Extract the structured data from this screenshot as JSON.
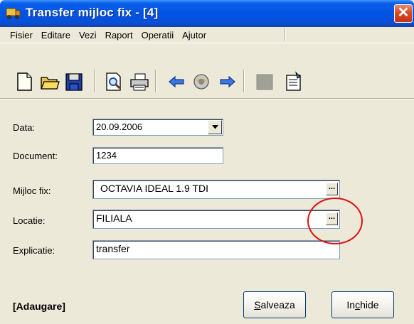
{
  "window": {
    "title": "Transfer mijloc fix - [4]",
    "close_glyph": "✕"
  },
  "menu": [
    "Fisier",
    "Editare",
    "Vezi",
    "Raport",
    "Operatii",
    "Ajutor"
  ],
  "toolbar": {
    "icons": [
      "new-document-icon",
      "open-folder-icon",
      "save-disk-icon",
      "print-preview-icon",
      "print-icon",
      "back-arrow-icon",
      "search-globe-icon",
      "forward-arrow-icon",
      "grey-box-icon",
      "properties-icon"
    ]
  },
  "form": {
    "data_label": "Data:",
    "data_value": "20.09.2006",
    "document_label": "Document:",
    "document_value": "1234",
    "mijloc_label": "Mijloc fix:",
    "mijloc_value": "OCTAVIA IDEAL 1.9 TDI",
    "locatie_label": "Locatie:",
    "locatie_value": "FILIALA",
    "explicatie_label": "Explicatie:",
    "explicatie_value": "transfer",
    "browse_glyph": "..."
  },
  "footer": {
    "status": "[Adaugare]",
    "save_label_underlined": "S",
    "save_label_rest": "alveaza",
    "close_label_pre": "In",
    "close_label_underlined": "c",
    "close_label_rest": "hide"
  },
  "colors": {
    "titlebar": "#0054e3",
    "window_bg": "#ece9d8",
    "highlight_circle": "#e01010"
  }
}
